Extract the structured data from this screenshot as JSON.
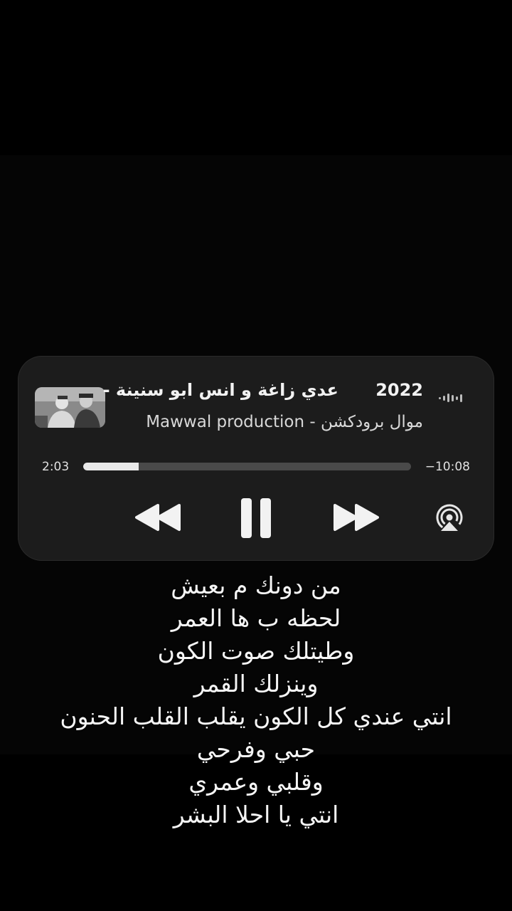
{
  "player": {
    "title": "عدي زاغة و انس ابو سنينة -",
    "year": "2022",
    "artist": "موال برودكشن - Mawwal production",
    "elapsed": "2:03",
    "remaining": "−10:08",
    "progress_fraction": 0.17,
    "icons": {
      "artwork": "album-art",
      "wave": "audio-wave-icon",
      "rewind": "rewind-icon",
      "pause": "pause-icon",
      "forward": "fast-forward-icon",
      "airplay": "airplay-icon"
    }
  },
  "lyrics": [
    "من دونك م بعيش",
    "لحظه ب ها العمر",
    "وطيتلك صوت الكون",
    "وينزلك القمر",
    "انتي عندي كل الكون يقلب القلب الحنون",
    "حبي وفرحي",
    "وقلبي وعمري",
    "انتي يا احلا البشر"
  ],
  "colors": {
    "background": "#000000",
    "player_bg": "#1c1c1c",
    "progress_track": "#4a4a4a",
    "progress_fill": "#e9e9e9"
  }
}
